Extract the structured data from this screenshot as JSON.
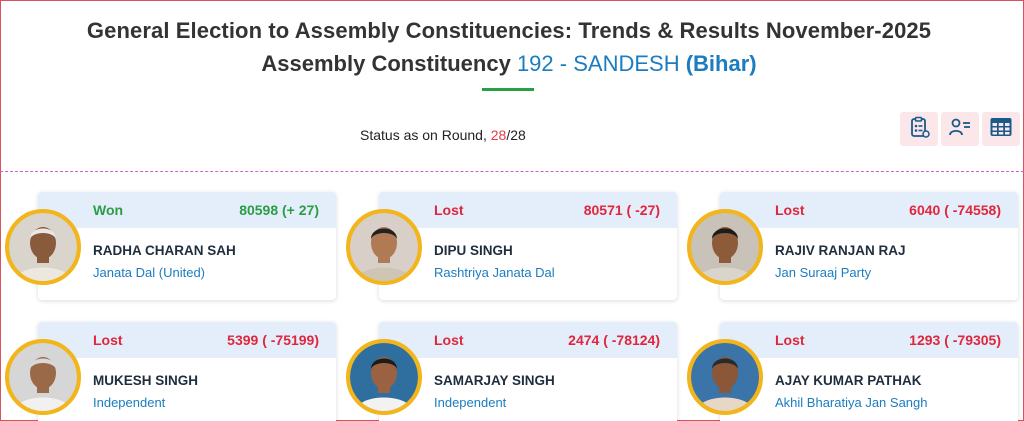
{
  "header": {
    "title_line1": "General Election to Assembly Constituencies: Trends & Results November-2025",
    "title_line2_prefix": "Assembly Constituency",
    "constituency_no": "192 -",
    "constituency_name": "SANDESH",
    "state": "(Bihar)"
  },
  "status": {
    "label": "Status as on Round,",
    "current_round": "28",
    "total_rounds": "/28"
  },
  "toolbar": {
    "buttons": [
      "clipboard-list-icon",
      "user-list-icon",
      "table-grid-icon"
    ]
  },
  "colors": {
    "won": "#2a9d45",
    "lost": "#e0263c",
    "accent_blue": "#1b7dbf",
    "card_header": "#e4eefb",
    "avatar_ring": "#f2b51b"
  },
  "candidates": [
    {
      "status": "Won",
      "votes": "80598 (+ 27)",
      "name": "RADHA CHARAN SAH",
      "party": "Janata Dal (United)"
    },
    {
      "status": "Lost",
      "votes": "80571 ( -27)",
      "name": "DIPU SINGH",
      "party": "Rashtriya Janata Dal"
    },
    {
      "status": "Lost",
      "votes": "6040 ( -74558)",
      "name": "RAJIV RANJAN RAJ",
      "party": "Jan Suraaj Party"
    },
    {
      "status": "Lost",
      "votes": "5399 ( -75199)",
      "name": "MUKESH SINGH",
      "party": "Independent"
    },
    {
      "status": "Lost",
      "votes": "2474 ( -78124)",
      "name": "SAMARJAY SINGH",
      "party": "Independent"
    },
    {
      "status": "Lost",
      "votes": "1293 ( -79305)",
      "name": "AJAY KUMAR PATHAK",
      "party": "Akhil Bharatiya Jan Sangh"
    }
  ]
}
